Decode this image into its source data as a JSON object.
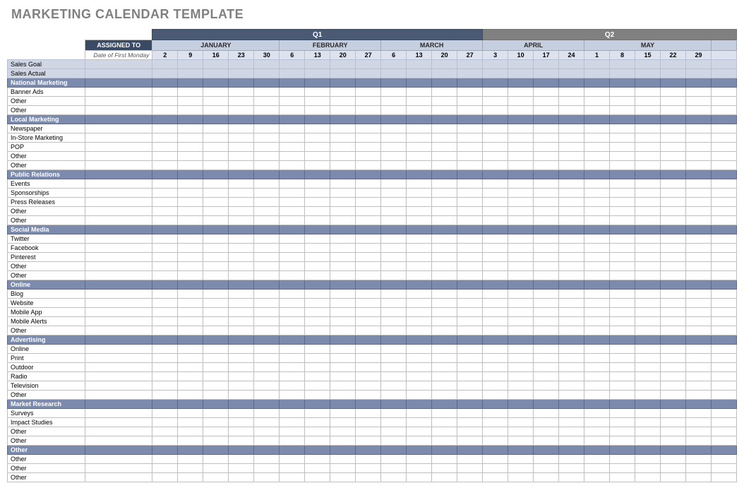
{
  "title": "MARKETING CALENDAR TEMPLATE",
  "headers": {
    "assigned_to": "ASSIGNED TO",
    "date_of_first_monday": "Date of First Monday",
    "q1": "Q1",
    "q2": "Q2"
  },
  "months": {
    "jan": {
      "label": "JANUARY",
      "weeks": [
        "2",
        "9",
        "16",
        "23",
        "30"
      ]
    },
    "feb": {
      "label": "FEBRUARY",
      "weeks": [
        "6",
        "13",
        "20",
        "27"
      ]
    },
    "mar": {
      "label": "MARCH",
      "weeks": [
        "6",
        "13",
        "20",
        "27"
      ]
    },
    "apr": {
      "label": "APRIL",
      "weeks": [
        "3",
        "10",
        "17",
        "24"
      ]
    },
    "may": {
      "label": "MAY",
      "weeks": [
        "1",
        "8",
        "15",
        "22",
        "29"
      ]
    }
  },
  "rows": [
    {
      "type": "sales",
      "label": "Sales Goal"
    },
    {
      "type": "sales",
      "label": "Sales Actual"
    },
    {
      "type": "cat",
      "label": "National Marketing"
    },
    {
      "type": "data",
      "label": "Banner Ads"
    },
    {
      "type": "data",
      "label": "Other"
    },
    {
      "type": "data",
      "label": "Other"
    },
    {
      "type": "cat",
      "label": "Local Marketing"
    },
    {
      "type": "data",
      "label": "Newspaper"
    },
    {
      "type": "data",
      "label": "In-Store Marketing"
    },
    {
      "type": "data",
      "label": "POP"
    },
    {
      "type": "data",
      "label": "Other"
    },
    {
      "type": "data",
      "label": "Other"
    },
    {
      "type": "cat",
      "label": "Public Relations"
    },
    {
      "type": "data",
      "label": "Events"
    },
    {
      "type": "data",
      "label": "Sponsorships"
    },
    {
      "type": "data",
      "label": "Press Releases"
    },
    {
      "type": "data",
      "label": "Other"
    },
    {
      "type": "data",
      "label": "Other"
    },
    {
      "type": "cat",
      "label": "Social Media"
    },
    {
      "type": "data",
      "label": "Twitter"
    },
    {
      "type": "data",
      "label": "Facebook"
    },
    {
      "type": "data",
      "label": "Pinterest"
    },
    {
      "type": "data",
      "label": "Other"
    },
    {
      "type": "data",
      "label": "Other"
    },
    {
      "type": "cat",
      "label": "Online"
    },
    {
      "type": "data",
      "label": "Blog"
    },
    {
      "type": "data",
      "label": "Website"
    },
    {
      "type": "data",
      "label": "Mobile App"
    },
    {
      "type": "data",
      "label": "Mobile Alerts"
    },
    {
      "type": "data",
      "label": "Other"
    },
    {
      "type": "cat",
      "label": "Advertising"
    },
    {
      "type": "data",
      "label": "Online"
    },
    {
      "type": "data",
      "label": "Print"
    },
    {
      "type": "data",
      "label": "Outdoor"
    },
    {
      "type": "data",
      "label": "Radio"
    },
    {
      "type": "data",
      "label": "Television"
    },
    {
      "type": "data",
      "label": "Other"
    },
    {
      "type": "cat",
      "label": "Market Research"
    },
    {
      "type": "data",
      "label": "Surveys"
    },
    {
      "type": "data",
      "label": "Impact Studies"
    },
    {
      "type": "data",
      "label": "Other"
    },
    {
      "type": "data",
      "label": "Other"
    },
    {
      "type": "cat-other",
      "label": "Other"
    },
    {
      "type": "data",
      "label": "Other"
    },
    {
      "type": "data",
      "label": "Other"
    },
    {
      "type": "data",
      "label": "Other"
    }
  ]
}
